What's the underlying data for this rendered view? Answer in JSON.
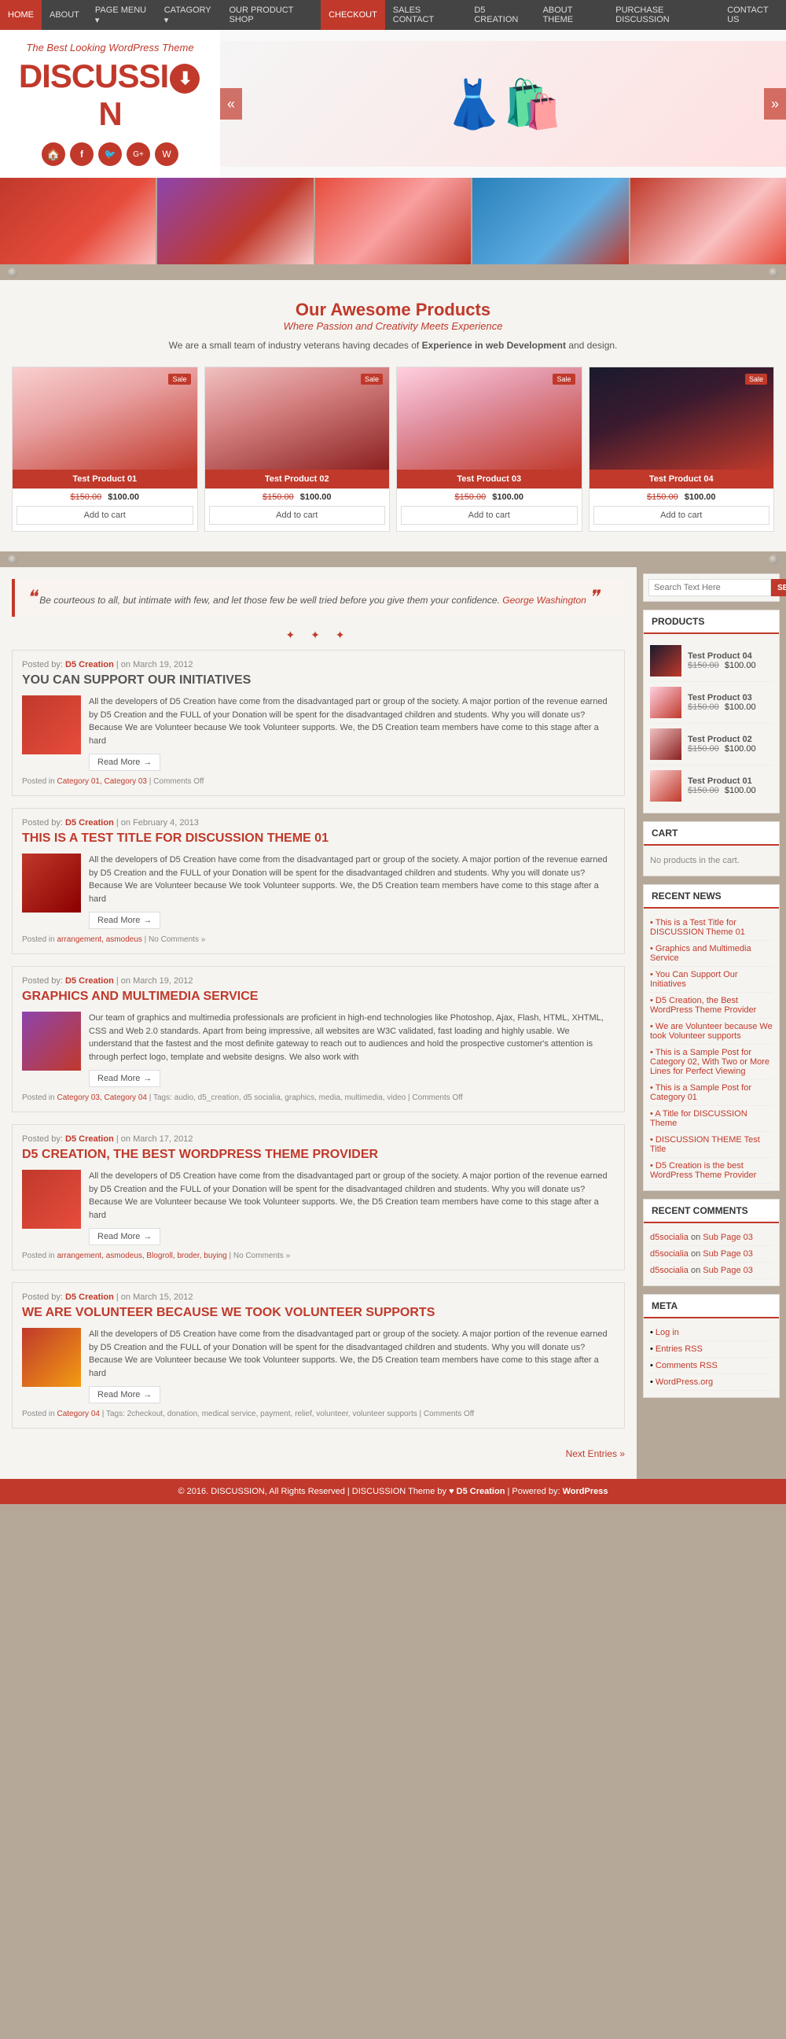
{
  "nav": {
    "items": [
      {
        "label": "HOME",
        "active": true
      },
      {
        "label": "ABOUT"
      },
      {
        "label": "PAGE MENU ▾"
      },
      {
        "label": "CATAGORY ▾"
      },
      {
        "label": "OUR PRODUCT SHOP"
      },
      {
        "label": "CHECKOUT",
        "highlight": true
      },
      {
        "label": "SALES CONTACT"
      },
      {
        "label": "D5 CREATION"
      },
      {
        "label": "ABOUT THEME"
      },
      {
        "label": "PURCHASE DISCUSSION"
      },
      {
        "label": "CONTACT US"
      }
    ]
  },
  "header": {
    "tagline": "The Best Looking WordPress Theme",
    "logo_text_left": "DISCUSSI",
    "logo_text_right": "N",
    "social_icons": [
      "🏠",
      "f",
      "🐦",
      "G+",
      "W"
    ]
  },
  "products_section": {
    "title": "Our Awesome Products",
    "subtitle": "Where Passion and Creativity Meets Experience",
    "description": "We are a small team of industry veterans having decades of Experience in web Development and design.",
    "products": [
      {
        "name": "Test Product 01",
        "old_price": "$150.00",
        "new_price": "$100.00",
        "badge": "Sale",
        "add_label": "Add to cart"
      },
      {
        "name": "Test Product 02",
        "old_price": "$150.00",
        "new_price": "$100.00",
        "badge": "Sale",
        "add_label": "Add to cart"
      },
      {
        "name": "Test Product 03",
        "old_price": "$150.00",
        "new_price": "$100.00",
        "badge": "Sale",
        "add_label": "Add to cart"
      },
      {
        "name": "Test Product 04",
        "old_price": "$150.00",
        "new_price": "$100.00",
        "badge": "Sale",
        "add_label": "Add to cart"
      }
    ]
  },
  "quote": {
    "text": "Be courteous to all, but intimate with few, and let those few be well tried before you give them your confidence.",
    "author": "George Washington"
  },
  "posts": [
    {
      "author": "D5 Creation",
      "date": "March 19, 2012",
      "title": "YOU CAN SUPPORT OUR INITIATIVES",
      "body": "All the developers of D5 Creation have come from the disadvantaged part or group of the society. A major portion of the revenue earned by D5 Creation and the FULL of your Donation will be spent for the disadvantaged children and students. Why you will donate us? Because We are Volunteer because We took Volunteer supports. We, the D5 Creation team members have come to this stage after a hard",
      "read_more": "Read More",
      "categories": "Category 01, Category 03",
      "comments": "Comments Off"
    },
    {
      "author": "D5 Creation",
      "date": "February 4, 2013",
      "title": "THIS IS A TEST TITLE FOR DISCUSSION THEME 01",
      "body": "All the developers of D5 Creation have come from the disadvantaged part or group of the society. A major portion of the revenue earned by D5 Creation and the FULL of your Donation will be spent for the disadvantaged children and students. Why you will donate us? Because We are Volunteer because We took Volunteer supports. We, the D5 Creation team members have come to this stage after a hard",
      "read_more": "Read More",
      "categories": "arrangement, asmodeus",
      "comments": "No Comments »"
    },
    {
      "author": "D5 Creation",
      "date": "March 19, 2012",
      "title": "GRAPHICS AND MULTIMEDIA SERVICE",
      "body": "Our team of graphics and multimedia professionals are proficient in high-end technologies like Photoshop, Ajax, Flash, HTML, XHTML, CSS and Web 2.0 standards. Apart from being impressive, all websites are W3C validated, fast loading and highly usable. We understand that the fastest and the most definite gateway to reach out to audiences and hold the prospective customer's attention is through perfect logo, template and website designs. We also work with",
      "read_more": "Read More",
      "categories": "Category 03, Category 04",
      "tags": "audio, d5_creation, d5 socialia, graphics, media, multimedia, video",
      "comments": "Comments Off"
    },
    {
      "author": "D5 Creation",
      "date": "March 17, 2012",
      "title": "D5 CREATION, THE BEST WORDPRESS THEME PROVIDER",
      "body": "All the developers of D5 Creation have come from the disadvantaged part or group of the society. A major portion of the revenue earned by D5 Creation and the FULL of your Donation will be spent for the disadvantaged children and students. Why you will donate us? Because We are Volunteer because We took Volunteer supports. We, the D5 Creation team members have come to this stage after a hard",
      "read_more": "Read More",
      "categories": "arrangement, asmodeus, Blogroll, broder, buying",
      "comments": "No Comments »"
    },
    {
      "author": "D5 Creation",
      "date": "March 15, 2012",
      "title": "WE ARE VOLUNTEER BECAUSE WE TOOK VOLUNTEER SUPPORTS",
      "body": "All the developers of D5 Creation have come from the disadvantaged part or group of the society. A major portion of the revenue earned by D5 Creation and the FULL of your Donation will be spent for the disadvantaged children and students. Why you will donate us? Because We are Volunteer because We took Volunteer supports. We, the D5 Creation team members have come to this stage after a hard",
      "read_more": "Read More",
      "categories": "Category 04",
      "tags": "2checkout, donation, medical service, payment, relief, volunteer, volunteer supports",
      "comments": "Comments Off"
    }
  ],
  "next_entries": "Next Entries »",
  "sidebar": {
    "search": {
      "placeholder": "Search Text Here",
      "button_label": "SEARCH"
    },
    "products_widget": {
      "title": "PRODUCTS",
      "items": [
        {
          "name": "Test Product 04",
          "old_price": "$150.00",
          "new_price": "$100.00"
        },
        {
          "name": "Test Product 03",
          "old_price": "$150.00",
          "new_price": "$100.00"
        },
        {
          "name": "Test Product 02",
          "old_price": "$150.00",
          "new_price": "$100.00"
        },
        {
          "name": "Test Product 01",
          "old_price": "$150.00",
          "new_price": "$100.00"
        }
      ]
    },
    "cart_widget": {
      "title": "CART",
      "empty_message": "No products in the cart."
    },
    "recent_news": {
      "title": "RECENT NEWS",
      "items": [
        "This is a Test Title for DISCUSSION Theme 01",
        "Graphics and Multimedia Service",
        "You Can Support Our Initiatives",
        "D5 Creation, the Best WordPress Theme Provider",
        "We are Volunteer because We took Volunteer supports",
        "This is a Sample Post for Category 02, With Two or More Lines for Perfect Viewing",
        "This is a Sample Post for Category 01",
        "A Title for DISCUSSION Theme",
        "DISCUSSION THEME Test Title",
        "D5 Creation is the best WordPress Theme Provider"
      ]
    },
    "recent_comments": {
      "title": "RECENT COMMENTS",
      "items": [
        {
          "author": "d5socialia",
          "on": "Sub Page 03"
        },
        {
          "author": "d5socialia",
          "on": "Sub Page 03"
        },
        {
          "author": "d5socialia",
          "on": "Sub Page 03"
        }
      ]
    },
    "meta": {
      "title": "META",
      "items": [
        {
          "label": "Log in"
        },
        {
          "label": "Entries RSS"
        },
        {
          "label": "Comments RSS"
        },
        {
          "label": "WordPress.org"
        }
      ]
    }
  },
  "footer": {
    "copyright": "© 2016. DISCUSSION, All Rights Reserved | DISCUSSION Theme by",
    "brand": "D5 Creation",
    "powered": "| Powered by:",
    "powered_by": "WordPress"
  }
}
